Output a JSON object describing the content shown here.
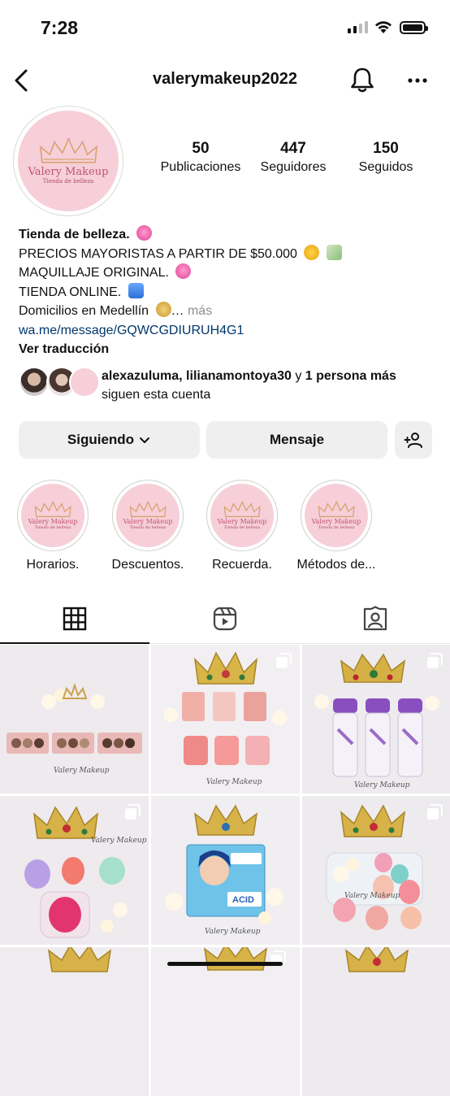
{
  "status_bar": {
    "time": "7:28"
  },
  "header": {
    "username": "valerymakeup2022"
  },
  "profile": {
    "logo_line1": "Valery Makeup",
    "logo_line2": "Tienda de belleza",
    "stats": [
      {
        "value": "50",
        "label": "Publicaciones"
      },
      {
        "value": "447",
        "label": "Seguidores"
      },
      {
        "value": "150",
        "label": "Seguidos"
      }
    ],
    "bio": {
      "title": "Tienda de belleza.",
      "line1": "PRECIOS MAYORISTAS A PARTIR DE $50.000",
      "line2": "MAQUILLAJE ORIGINAL.",
      "line3": "TIENDA ONLINE.",
      "line4": "Domicilios en Medellín",
      "ellipsis": "…",
      "more": "más",
      "link": "wa.me/message/GQWCGDIURUH4G1",
      "translate": "Ver traducción"
    },
    "followed_by": {
      "names": "alexazuluma, lilianamontoya30",
      "connector": "y",
      "others": "1 persona más",
      "suffix": "siguen esta cuenta"
    }
  },
  "actions": {
    "following": "Siguiendo",
    "message": "Mensaje"
  },
  "highlights": [
    {
      "label": "Horarios."
    },
    {
      "label": "Descuentos."
    },
    {
      "label": "Recuerda."
    },
    {
      "label": "Métodos de..."
    }
  ],
  "watermark": "Valery Makeup",
  "product_labels": {
    "acid": "ACID"
  },
  "colors": {
    "link": "#00376b",
    "logo_pink": "#f6cfd8",
    "button_bg": "#efefef",
    "secondary_text": "#8e8e8e"
  },
  "icons": {
    "tabs": [
      "grid-icon",
      "reels-icon",
      "tagged-icon"
    ],
    "header": [
      "chevron-left-icon",
      "bell-icon",
      "more-icon"
    ]
  }
}
